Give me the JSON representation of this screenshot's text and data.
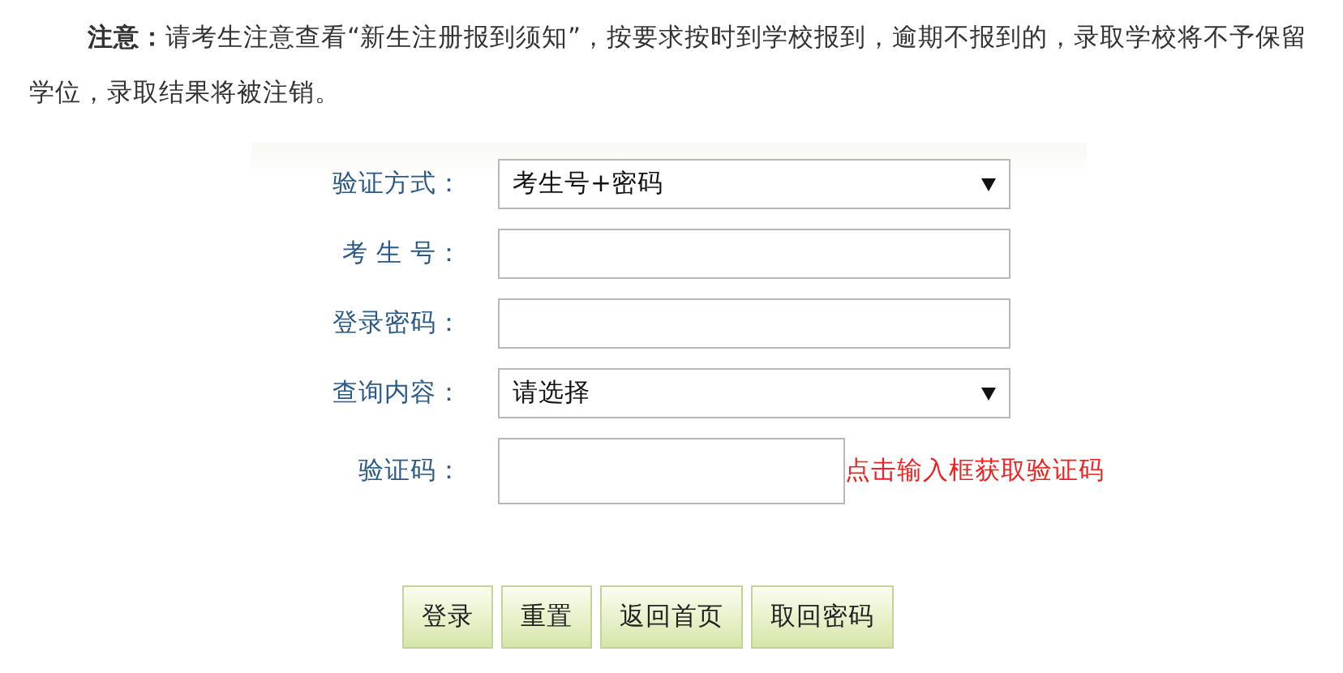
{
  "notice": "**注意：**请考生注意查看“新生注册报到须知”，按要求按时到学校报到，逾期不报到的，录取学校将不予保留学位，录取结果将被注销。",
  "form": {
    "fields": [
      {
        "label": "验证方式：",
        "kind": "select",
        "value": "考生号+密码"
      },
      {
        "label": "考 生 号：",
        "kind": "input"
      },
      {
        "label": "登录密码：",
        "kind": "input"
      },
      {
        "label": "查询内容：",
        "kind": "select",
        "value": "请选择"
      },
      {
        "label": "验证码：",
        "kind": "captcha",
        "hint": "点击输入框获取验证码"
      }
    ]
  },
  "buttons": [
    "登录",
    "重置",
    "返回首页",
    "取回密码"
  ]
}
